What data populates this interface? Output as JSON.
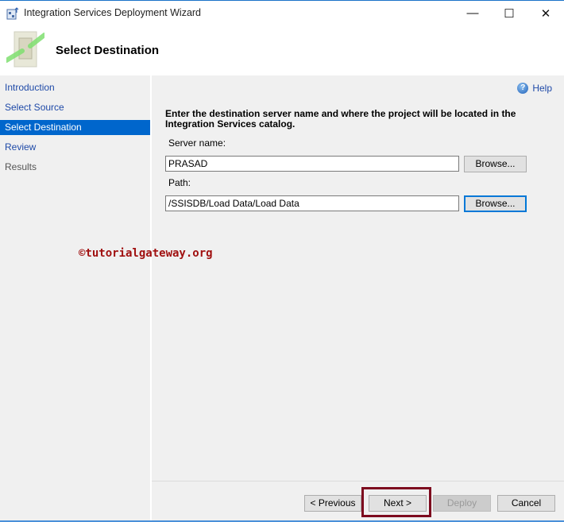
{
  "window": {
    "title": "Integration Services Deployment Wizard",
    "minimize": "—",
    "maximize": "☐",
    "close": "✕"
  },
  "header": {
    "title": "Select Destination"
  },
  "sidebar": {
    "items": [
      {
        "label": "Introduction",
        "state": "normal"
      },
      {
        "label": "Select Source",
        "state": "normal"
      },
      {
        "label": "Select Destination",
        "state": "active"
      },
      {
        "label": "Review",
        "state": "normal"
      },
      {
        "label": "Results",
        "state": "disabled"
      }
    ]
  },
  "main": {
    "help_label": "Help",
    "instruction": "Enter the destination server name and where the project will be located in the Integration Services catalog.",
    "server_label": "Server name:",
    "server_value": "PRASAD",
    "path_label": "Path:",
    "path_value": "/SSISDB/Load Data/Load Data",
    "browse_label": "Browse...",
    "watermark": "©tutorialgateway.org"
  },
  "footer": {
    "previous": "< Previous",
    "next": "Next >",
    "deploy": "Deploy",
    "cancel": "Cancel"
  }
}
